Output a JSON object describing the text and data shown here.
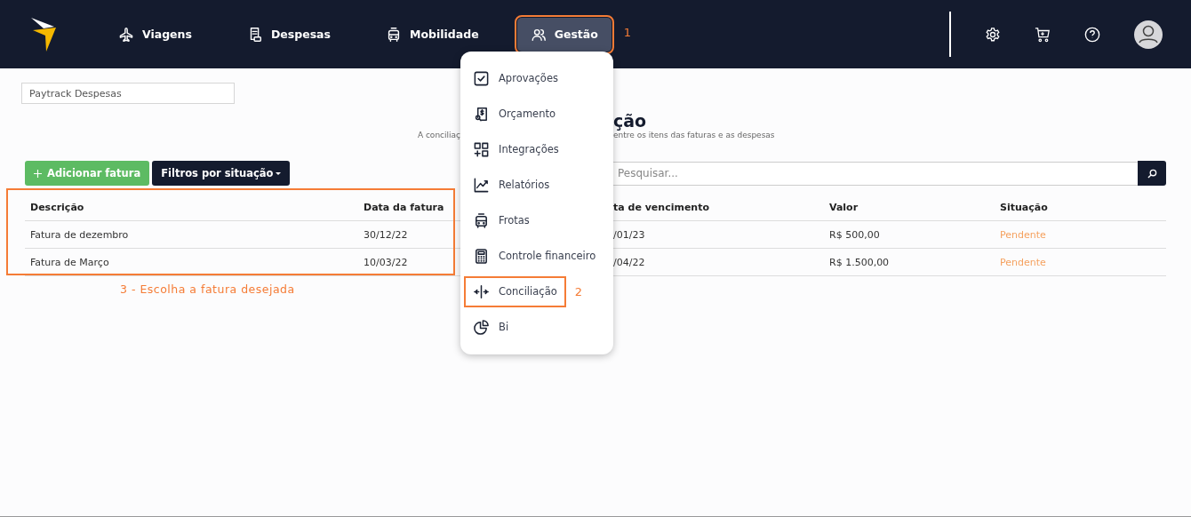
{
  "navbar": {
    "items": [
      {
        "label": "Viagens",
        "selected": false,
        "highlighted": false
      },
      {
        "label": "Despesas",
        "selected": false,
        "highlighted": false
      },
      {
        "label": "Mobilidade",
        "selected": false,
        "highlighted": false
      },
      {
        "label": "Gestão",
        "selected": true,
        "highlighted": true,
        "step": "1"
      }
    ]
  },
  "gestao_menu": {
    "items": [
      {
        "label": "Aprovações",
        "highlighted": false
      },
      {
        "label": "Orçamento",
        "highlighted": false
      },
      {
        "label": "Integrações",
        "highlighted": false
      },
      {
        "label": "Relatórios",
        "highlighted": false
      },
      {
        "label": "Frotas",
        "highlighted": false
      },
      {
        "label": "Controle financeiro",
        "highlighted": false
      },
      {
        "label": "Conciliação",
        "highlighted": true,
        "step": "2"
      },
      {
        "label": "Bi",
        "highlighted": false
      }
    ]
  },
  "company_field": {
    "value": "Paytrack Despesas"
  },
  "page_title_visible": "ção",
  "subtitle_visible": [
    "A conciliaç",
    "entre os itens das faturas e as despesas"
  ],
  "buttons": [
    {
      "label": "Adicionar fatura",
      "kind": "add"
    },
    {
      "label": "Filtros por situação",
      "kind": "dropdown"
    }
  ],
  "search": {
    "placeholder": "Pesquisar..."
  },
  "table": {
    "highlighted": true,
    "step": "3 - Escolha a fatura desejada",
    "columns": [
      "Descrição",
      "Data da fatura",
      "ta de vencimento",
      "Valor",
      "Situação"
    ],
    "rows": [
      [
        "Fatura de dezembro",
        "30/12/22",
        "/01/23",
        "R$ 500,00",
        "Pendente"
      ],
      [
        "Fatura de Março",
        "10/03/22",
        "/04/22",
        "R$ 1.500,00",
        "Pendente"
      ]
    ]
  }
}
